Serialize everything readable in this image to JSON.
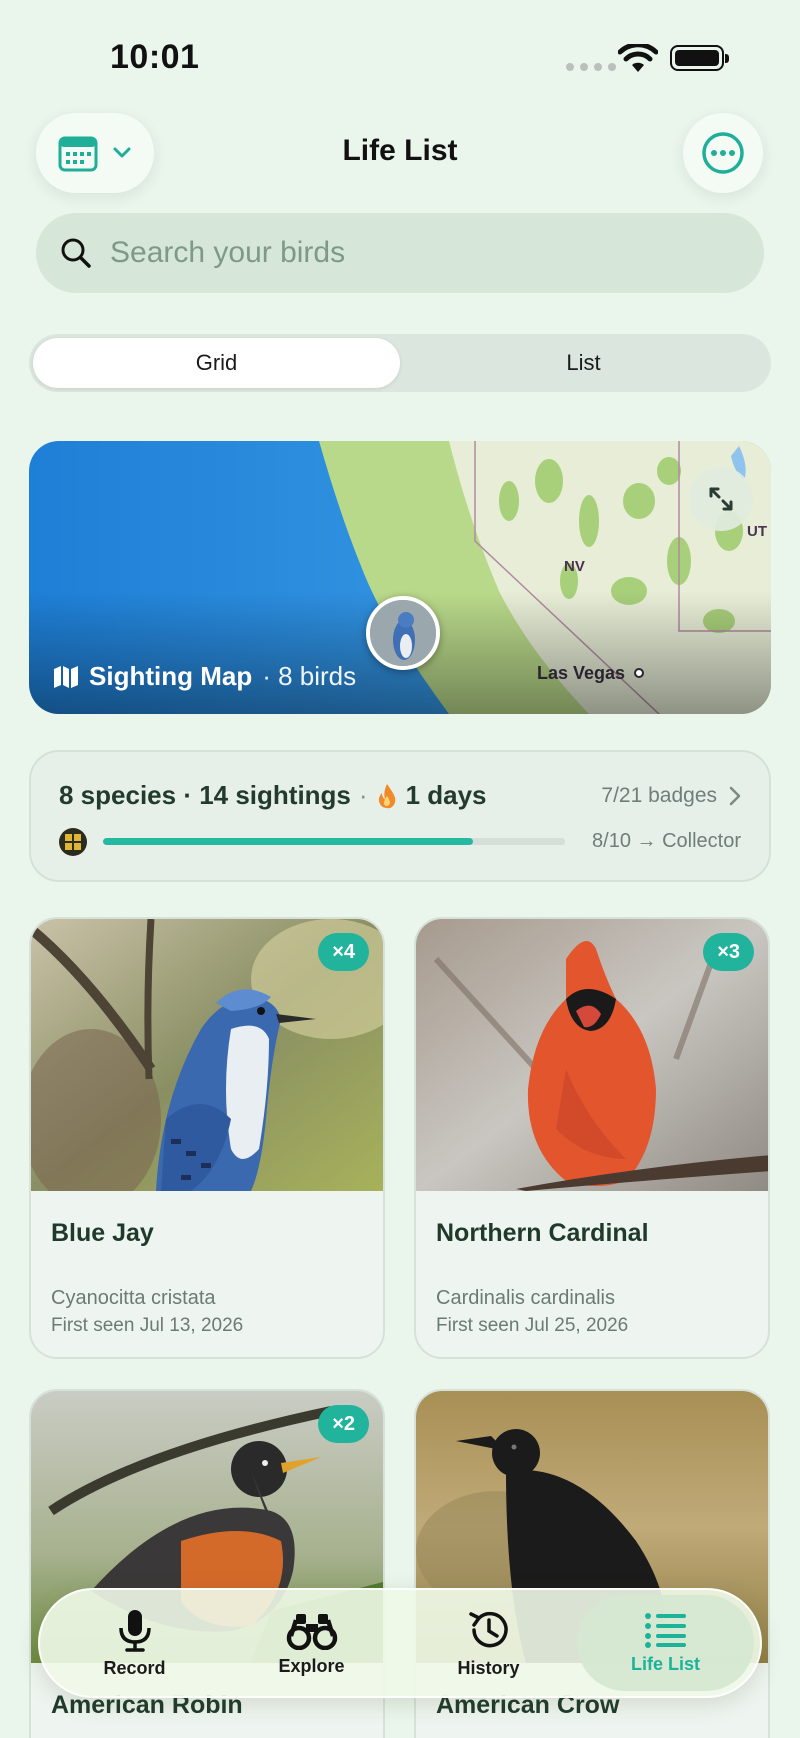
{
  "status_bar": {
    "time": "10:01"
  },
  "header": {
    "title": "Life List"
  },
  "search": {
    "placeholder": "Search your birds"
  },
  "view_toggle": {
    "options": [
      "Grid",
      "List"
    ],
    "selected": "Grid"
  },
  "map": {
    "title": "Sighting Map",
    "count": "· 8 birds",
    "places": [
      "NV",
      "UT",
      "Las Vegas"
    ]
  },
  "stats": {
    "species_sightings": "8 species · 14 sightings",
    "separator": "·",
    "streak": "1 days",
    "badges": "7/21 badges",
    "progress_label": "8/10 → Collector",
    "progress_fraction": 0.8
  },
  "birds": [
    {
      "count": "×4",
      "name": "Blue Jay",
      "scientific": "Cyanocitta cristata",
      "first_seen": "First seen Jul 13, 2026"
    },
    {
      "count": "×3",
      "name": "Northern Cardinal",
      "scientific": "Cardinalis cardinalis",
      "first_seen": "First seen Jul 25, 2026"
    },
    {
      "count": "×2",
      "name": "American Robin",
      "scientific": "",
      "first_seen": ""
    },
    {
      "count": "",
      "name": "American Crow",
      "scientific": "",
      "first_seen": ""
    }
  ],
  "tabs": [
    {
      "label": "Record",
      "icon": "microphone-icon"
    },
    {
      "label": "Explore",
      "icon": "binoculars-icon"
    },
    {
      "label": "History",
      "icon": "history-icon"
    },
    {
      "label": "Life List",
      "icon": "list-icon"
    }
  ],
  "colors": {
    "accent": "#22b39c",
    "background": "#eaf5ec",
    "text": "#1c2a22"
  }
}
